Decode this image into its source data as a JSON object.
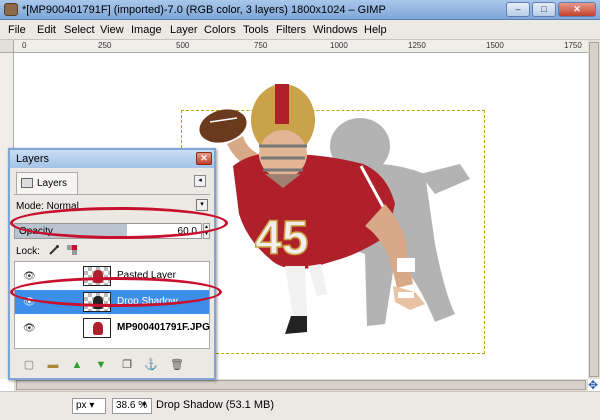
{
  "window": {
    "title": "*[MP900401791F] (imported)-7.0 (RGB color, 3 layers) 1800x1024 – GIMP",
    "minimize": "–",
    "maximize": "□",
    "close": "✕"
  },
  "menu": [
    "File",
    "Edit",
    "Select",
    "View",
    "Image",
    "Layer",
    "Colors",
    "Tools",
    "Filters",
    "Windows",
    "Help"
  ],
  "ruler_top_labels": [
    "0",
    "250",
    "500",
    "750",
    "1000",
    "1250",
    "1500",
    "1750"
  ],
  "layers_dialog": {
    "title": "Layers",
    "close": "✕",
    "tab_label": "Layers",
    "tab_menu": "◂",
    "mode_label": "Mode: Normal",
    "mode_arrow": "▾",
    "opacity_label": "Opacity",
    "opacity_value": "60.0",
    "opacity_fraction": 0.6,
    "lock_label": "Lock:",
    "layers": [
      {
        "name": "Pasted Layer",
        "selected": false,
        "bold": false
      },
      {
        "name": "Drop Shadow",
        "selected": true,
        "bold": false
      },
      {
        "name": "MP900401791F.JPG",
        "selected": false,
        "bold": true
      }
    ]
  },
  "status": {
    "unit": "px",
    "zoom": "38.6 %",
    "layer_info": "Drop Shadow (53.1 MB)"
  },
  "colors": {
    "highlight": "#c8102e",
    "selection": "#3d8ee8",
    "jersey": "#b0202a",
    "helmet": "#c9a24a"
  },
  "icons": [
    "eye-icon",
    "lock-pixels-icon",
    "lock-alpha-icon",
    "new-layer-icon",
    "new-group-icon",
    "raise-layer-icon",
    "lower-layer-icon",
    "duplicate-layer-icon",
    "anchor-icon",
    "delete-layer-icon",
    "navigate-icon"
  ]
}
